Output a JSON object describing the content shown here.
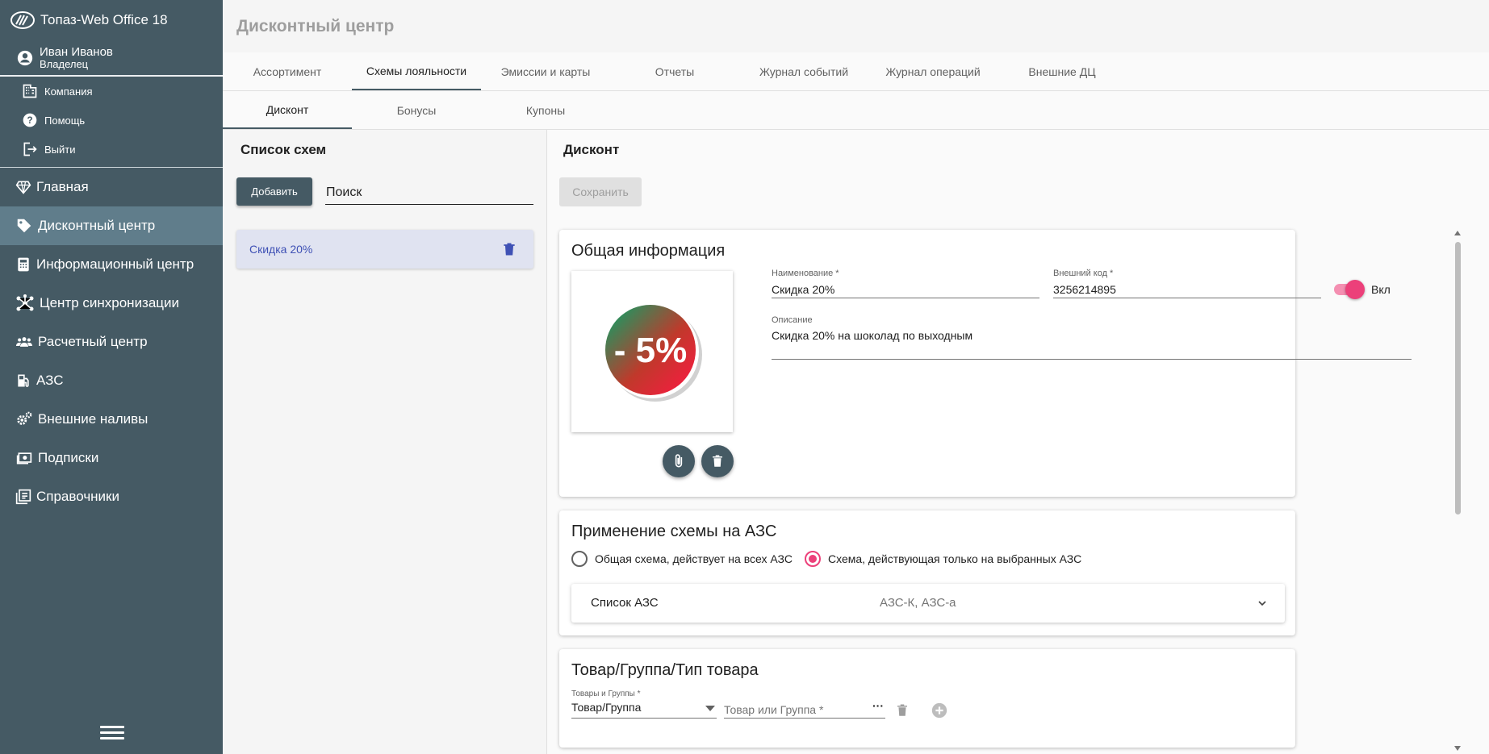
{
  "app": {
    "title": "Топаз-Web Office 18"
  },
  "user": {
    "name": "Иван Иванов",
    "role": "Владелец"
  },
  "account_menu": [
    {
      "label": "Компания",
      "icon": "building-icon"
    },
    {
      "label": "Помощь",
      "icon": "help-icon"
    },
    {
      "label": "Выйти",
      "icon": "logout-icon"
    }
  ],
  "nav": [
    {
      "label": "Главная",
      "icon": "diamond-icon"
    },
    {
      "label": "Дисконтный центр",
      "icon": "tag-icon",
      "active": true
    },
    {
      "label": "Информационный центр",
      "icon": "calculator-icon"
    },
    {
      "label": "Центр синхронизации",
      "icon": "hub-icon"
    },
    {
      "label": "Расчетный центр",
      "icon": "people-icon"
    },
    {
      "label": "АЗС",
      "icon": "fuel-icon"
    },
    {
      "label": "Внешние наливы",
      "icon": "gears-icon"
    },
    {
      "label": "Подписки",
      "icon": "subscription-icon"
    },
    {
      "label": "Справочники",
      "icon": "library-icon"
    }
  ],
  "page": {
    "title": "Дисконтный центр"
  },
  "tabs": [
    "Ассортимент",
    "Схемы лояльности",
    "Эмиссии и карты",
    "Отчеты",
    "Журнал событий",
    "Журнал операций",
    "Внешние ДЦ"
  ],
  "active_tab": "Схемы лояльности",
  "subtabs": [
    "Дисконт",
    "Бонусы",
    "Купоны"
  ],
  "active_subtab": "Дисконт",
  "list": {
    "title": "Список схем",
    "add_label": "Добавить",
    "search_placeholder": "Поиск",
    "items": [
      "Скидка 20%"
    ]
  },
  "detail": {
    "title": "Дисконт",
    "save_label": "Сохранить",
    "general": {
      "title": "Общая информация",
      "image_text": "- 5%",
      "name_label": "Наименование *",
      "name_value": "Скидка 20%",
      "code_label": "Внешний код *",
      "code_value": "3256214895",
      "toggle_label": "Вкл",
      "toggle_on": true,
      "desc_label": "Описание",
      "desc_value": "Скидка 20% на шоколад по выходным"
    },
    "stations": {
      "title": "Применение схемы на АЗС",
      "radio_all": "Общая схема, действует на всех АЗС",
      "radio_selected": "Схема, действующая только на выбранных АЗС",
      "selected": "radio_selected",
      "list_label": "Список АЗС",
      "list_value": "АЗС-К, АЗС-а"
    },
    "goods": {
      "title": "Товар/Группа/Тип товара",
      "select_label": "Товары и Группы *",
      "select_value": "Товар/Группа",
      "input_placeholder": "Товар или Группа *",
      "more_label": "···"
    }
  },
  "colors": {
    "sidebar": "#455a64",
    "accent": "#ec407a",
    "link": "#3f51b5"
  }
}
